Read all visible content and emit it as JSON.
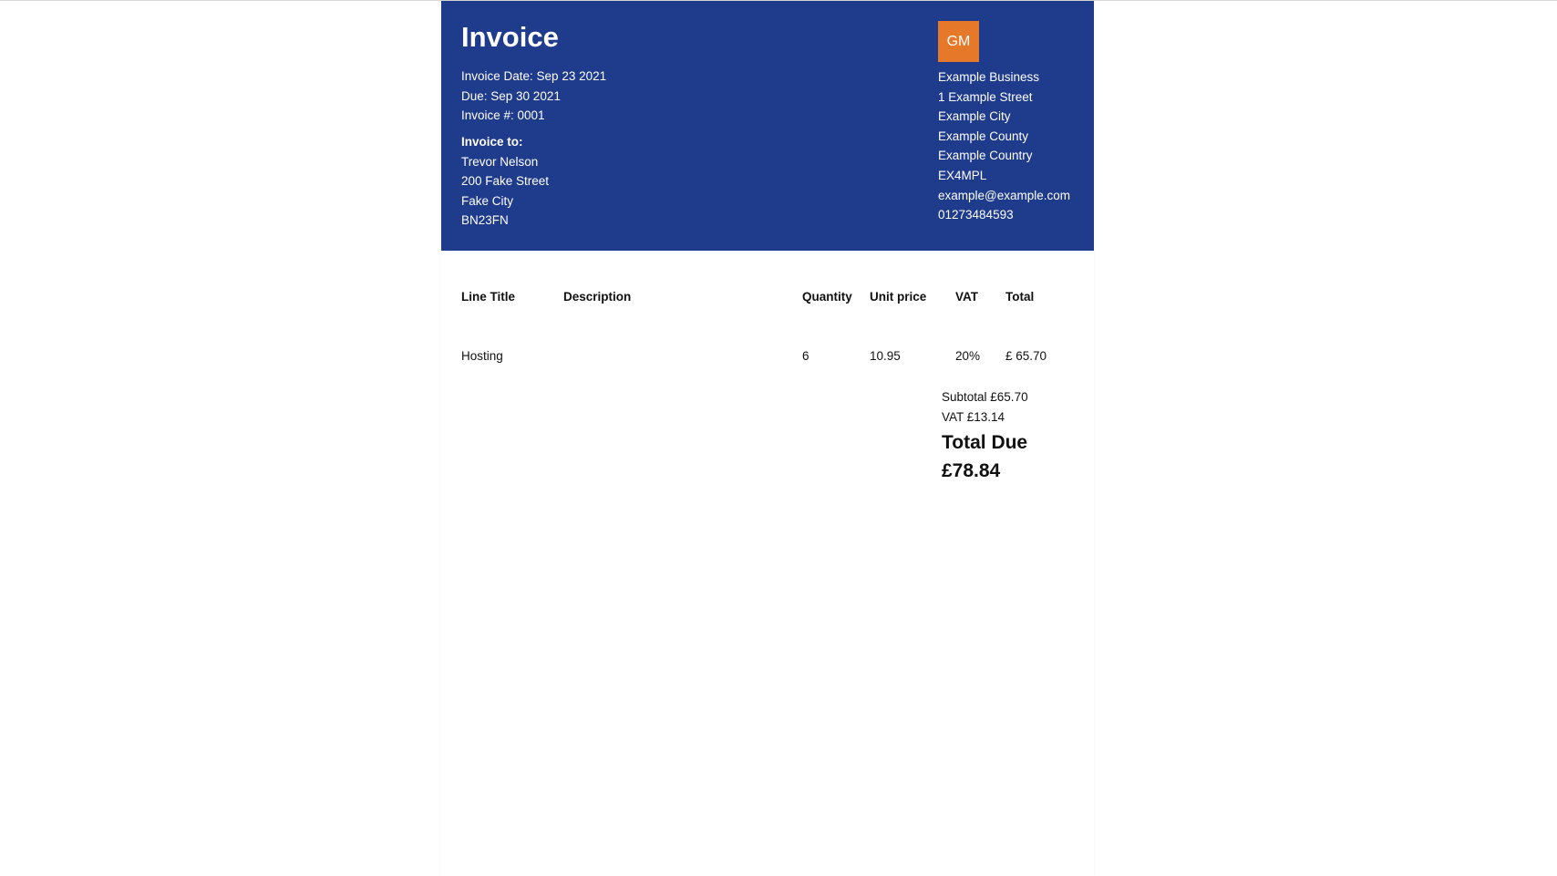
{
  "invoice": {
    "title": "Invoice",
    "date_line": "Invoice Date: Sep 23 2021",
    "due_line": "Due: Sep 30 2021",
    "number_line": "Invoice #: 0001"
  },
  "bill_to": {
    "label": "Invoice to:",
    "name": "Trevor Nelson",
    "street": "200 Fake Street",
    "city": "Fake City",
    "postcode": "BN23FN"
  },
  "business": {
    "logo_initials": "GM",
    "logo_color": "#e6782a",
    "name": "Example Business",
    "street": "1 Example Street",
    "city": "Example City",
    "county": "Example County",
    "country": "Example Country",
    "postcode": "EX4MPL",
    "email": "example@example.com",
    "phone": "01273484593"
  },
  "colors": {
    "header_bg": "#1f3b8c",
    "header_text": "#ffffff"
  },
  "table": {
    "headers": {
      "line_title": "Line Title",
      "description": "Description",
      "quantity": "Quantity",
      "unit_price": "Unit price",
      "vat": "VAT",
      "total": "Total"
    },
    "rows": [
      {
        "line_title": "Hosting",
        "description": "",
        "quantity": "6",
        "unit_price": "10.95",
        "vat": "20%",
        "total": "£ 65.70"
      }
    ]
  },
  "totals": {
    "subtotal": "Subtotal £65.70",
    "vat": "VAT £13.14",
    "total_due_label": "Total Due",
    "total_due_amount": "£78.84"
  }
}
